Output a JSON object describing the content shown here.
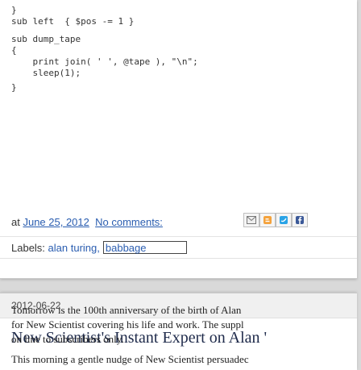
{
  "post1": {
    "code_lines": [
      "}",
      "sub left  { $pos -= 1 }",
      "",
      "sub dump_tape",
      "{",
      "    print join( ' ', @tape ), \"\\n\";",
      "    sleep(1);",
      "}"
    ],
    "footer": {
      "at_label": "at",
      "date": "June 25, 2012",
      "comments": "No comments:",
      "share_icons": [
        "email-icon",
        "blog-this-icon",
        "share-twitter-icon",
        "share-facebook-icon"
      ]
    },
    "labels": {
      "prefix": "Labels:",
      "items": [
        "alan turing,",
        "babbage"
      ]
    }
  },
  "post2": {
    "date": "2012-06-22",
    "title": "New Scientist's Instant Expert on Alan '",
    "para1": [
      "Tomorrow is the 100th anniversary of the birth of Alan ",
      "for New Scientist covering his life and work.  The suppl",
      "on line to subscribers only."
    ],
    "para2": "This morning a gentle nudge of New Scientist persuadec"
  },
  "colors": {
    "link": "#2a5db0",
    "title": "#1e2a4a",
    "background": "#d9d9d9"
  }
}
